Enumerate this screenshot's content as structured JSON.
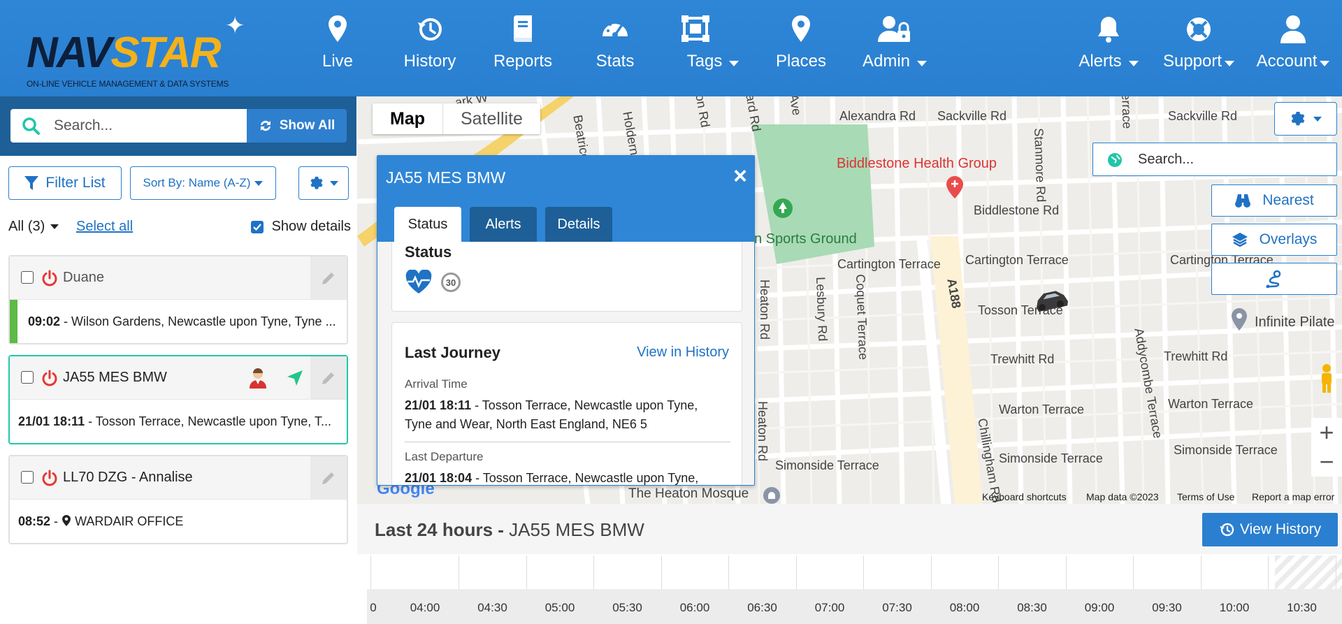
{
  "brand": {
    "logo_word_1": "NAV",
    "logo_word_2": "STAR",
    "logo_tagline": "ON-LINE VEHICLE MANAGEMENT & DATA SYSTEMS"
  },
  "nav": {
    "live": "Live",
    "history": "History",
    "reports": "Reports",
    "stats": "Stats",
    "tags": "Tags",
    "places": "Places",
    "admin": "Admin",
    "alerts": "Alerts",
    "support": "Support",
    "account": "Account"
  },
  "sidebar": {
    "search_placeholder": "Search...",
    "show_all": "Show All",
    "filter_list": "Filter List",
    "sort_by": "Sort By: Name (A-Z)",
    "all_count": "All (3)",
    "select_all": "Select all",
    "show_details": "Show details",
    "vehicles": [
      {
        "name": "Duane",
        "time": "09:02",
        "location": "Wilson Gardens, Newcastle upon Tyne, Tyne ..."
      },
      {
        "name": "JA55 MES BMW",
        "time": "21/01 18:11",
        "location": "Tosson Terrace, Newcastle upon Tyne, T..."
      },
      {
        "name": "LL70 DZG - Annalise",
        "time": "08:52",
        "location": "WARDAIR OFFICE"
      }
    ]
  },
  "map": {
    "type_map": "Map",
    "type_satellite": "Satellite",
    "search_placeholder": "Search...",
    "nearest": "Nearest",
    "overlays": "Overlays",
    "zoom_in": "+",
    "zoom_out": "−",
    "attribution": {
      "shortcuts": "Keyboard shortcuts",
      "map_data": "Map data ©2023",
      "terms": "Terms of Use",
      "report": "Report a map error"
    },
    "labels": {
      "alexandra_rd": "Alexandra Rd",
      "sackville_rd": "Sackville Rd",
      "sackville_rd_2": "Sackville Rd",
      "biddlestone_health": "Biddlestone Health Group",
      "biddlestone_rd": "Biddlestone Rd",
      "sports_ground": "n Sports Ground",
      "cartington_1": "Cartington Terrace",
      "cartington_2": "Cartington Terrace",
      "cartington_3": "Cartington Terrace",
      "tosson": "Tosson Terrace",
      "trewhitt_1": "Trewhitt Rd",
      "trewhitt_2": "Trewhitt Rd",
      "warton_1": "Warton Terrace",
      "warton_2": "Warton Terrace",
      "simonside_1": "Simonside Terrace",
      "simonside_2": "Simonside Terrace",
      "simonside_3": "Simonside Terrace",
      "heaton_mosque": "The Heaton Mosque",
      "infinite": "Infinite Pilate",
      "a188": "A188",
      "heaton_rd": "Heaton Rd",
      "heaton_rd_2": "Heaton Rd",
      "lesbury": "Lesbury Rd",
      "coquet": "Coquet Terrace",
      "stanmore": "Stanmore Rd",
      "addycombe": "Addycombe Terrace",
      "chillingham": "Chillingham Rd",
      "beatrice": "Beatrice",
      "holderness": "Holderness",
      "ark_w": "ark W",
      "on_rd": "on Rd",
      "ard_rd": "ard Rd",
      "ave": "Ave",
      "errace": "errace",
      "google": "Google"
    }
  },
  "popup": {
    "title": "JA55 MES BMW",
    "close": "×",
    "tabs": {
      "status": "Status",
      "alerts": "Alerts",
      "details": "Details"
    },
    "status_heading": "Status",
    "speed_limit": "30",
    "last_journey": "Last Journey",
    "view_in_history": "View in History",
    "arrival_label": "Arrival Time",
    "arrival_time": "21/01 18:11",
    "arrival_location": "Tosson Terrace, Newcastle upon Tyne,",
    "arrival_location_2": "Tyne and Wear, North East England, NE6 5",
    "departure_label": "Last Departure",
    "departure_time": "21/01 18:04",
    "departure_location": "Tosson Terrace, Newcastle upon Tyne,"
  },
  "timeline": {
    "title_bold": "Last 24 hours -",
    "title_vehicle": "JA55 MES BMW",
    "view_history": "View History",
    "ticks": [
      "0",
      "04:00",
      "04:30",
      "05:00",
      "05:30",
      "06:00",
      "06:30",
      "07:00",
      "07:30",
      "08:00",
      "08:30",
      "09:00",
      "09:30",
      "10:00",
      "10:30"
    ]
  },
  "colors": {
    "header_blue": "#2f86d6",
    "sidebar_band": "#1e5f97",
    "accent_blue": "#2a7fd0",
    "power_red": "#e53935",
    "online_green": "#5dbb45",
    "selected_teal": "#21c7a8"
  }
}
